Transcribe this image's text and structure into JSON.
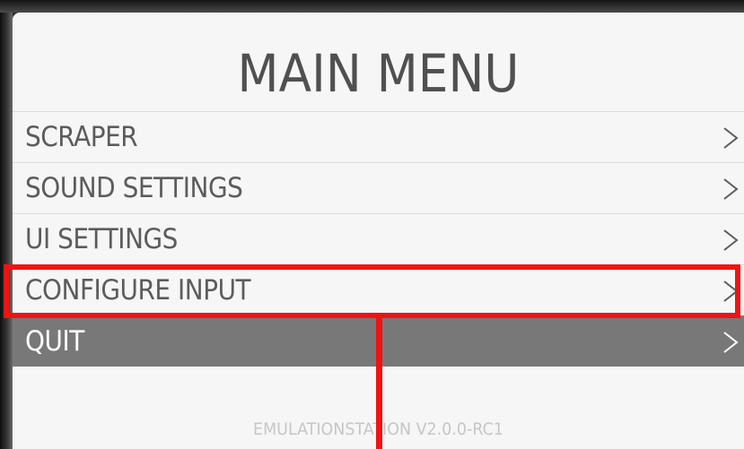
{
  "menu": {
    "title": "MAIN MENU",
    "items": [
      {
        "label": "SCRAPER",
        "icon": "chevron-right-icon",
        "selected": false
      },
      {
        "label": "SOUND SETTINGS",
        "icon": "chevron-right-icon",
        "selected": false
      },
      {
        "label": "UI SETTINGS",
        "icon": "chevron-right-icon",
        "selected": false
      },
      {
        "label": "CONFIGURE INPUT",
        "icon": "chevron-right-icon",
        "selected": false,
        "annotated": true
      },
      {
        "label": "QUIT",
        "icon": "chevron-right-icon",
        "selected": true
      }
    ],
    "footer": "EMULATIONSTATION V2.0.0-RC1"
  },
  "colors": {
    "panel_background": "#f6f6f6",
    "text": "#5c5c5c",
    "selected_background": "#787878",
    "selected_text": "#ffffff",
    "annotation": "#ef1313"
  }
}
